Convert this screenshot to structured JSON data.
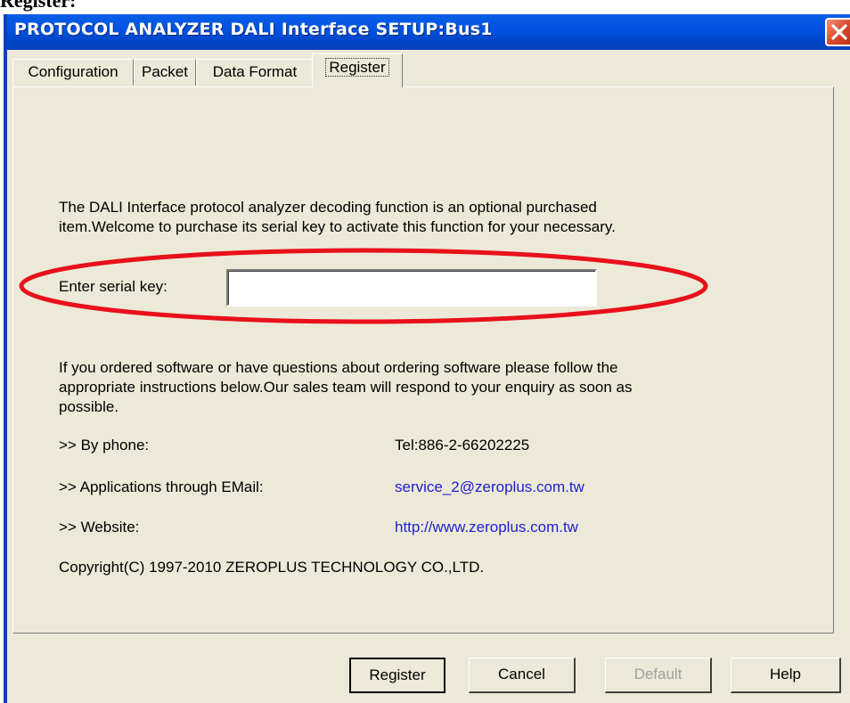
{
  "document": {
    "heading": "Register:"
  },
  "window": {
    "title": "PROTOCOL ANALYZER DALI Interface SETUP:Bus1"
  },
  "tabs": [
    {
      "label": "Configuration"
    },
    {
      "label": "Packet"
    },
    {
      "label": "Data Format"
    },
    {
      "label": "Register"
    }
  ],
  "register": {
    "intro_line1": "The DALI Interface protocol analyzer decoding function is an optional purchased",
    "intro_line2": "item.Welcome to purchase its serial key to activate this function for your necessary.",
    "serial_label": "Enter serial key:",
    "serial_value": "",
    "info_line1": "If you ordered software or have questions about ordering software please follow the",
    "info_line2": "appropriate instructions below.Our sales team will respond to your enquiry as soon as",
    "info_line3": "possible.",
    "phone_label": ">> By phone:",
    "phone_value": "Tel:886-2-66202225",
    "email_label": ">> Applications through EMail:",
    "email_value": "service_2@zeroplus.com.tw",
    "website_label": ">> Website:",
    "website_value": "http://www.zeroplus.com.tw",
    "copyright": "Copyright(C) 1997-2010 ZEROPLUS TECHNOLOGY CO.,LTD."
  },
  "buttons": {
    "register": "Register",
    "cancel": "Cancel",
    "default": "Default",
    "help": "Help"
  },
  "colors": {
    "titlebar": "#0053e1",
    "dialog_face": "#ece9d8",
    "link": "#1f1fd2",
    "highlight_ellipse": "#e8101a"
  },
  "icons": {
    "close": "close-icon"
  }
}
